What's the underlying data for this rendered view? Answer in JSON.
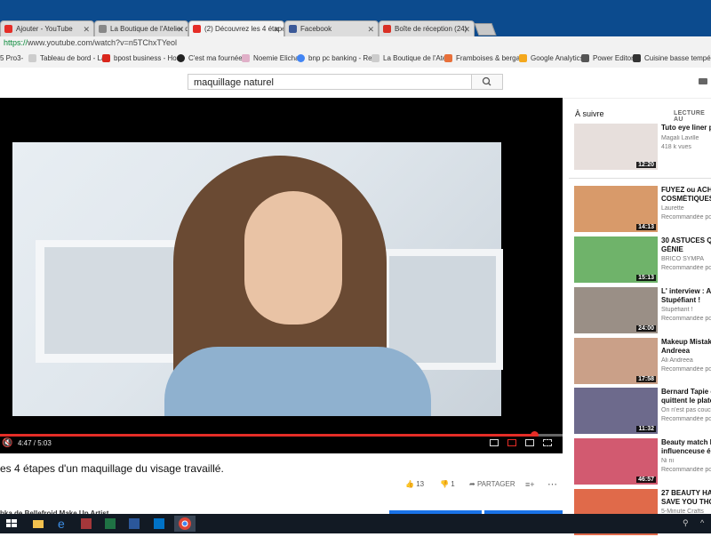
{
  "browser": {
    "tabs": [
      {
        "label": "Ajouter - YouTube",
        "icon": "youtube-icon",
        "color": "#e52d27"
      },
      {
        "label": "La Boutique de l'Atelier d",
        "icon": "page-icon",
        "color": "#888888"
      },
      {
        "label": "(2) Découvrez les 4 étape",
        "icon": "youtube-icon",
        "color": "#e52d27"
      },
      {
        "label": "Facebook",
        "icon": "facebook-icon",
        "color": "#3b5998"
      },
      {
        "label": "Boîte de réception (24)",
        "icon": "gmail-icon",
        "color": "#d93025"
      }
    ],
    "url_scheme": "https://",
    "url_rest": "www.youtube.com/watch?v=n5TChxTYeol",
    "bookmarks": [
      {
        "label": "5 Pro3-",
        "color": "#5a8fd6"
      },
      {
        "label": "Tableau de bord - La",
        "color": "#cccccc"
      },
      {
        "label": "bpost business - Hor",
        "color": "#d9261c"
      },
      {
        "label": "C'est ma fournée |",
        "color": "#222222"
      },
      {
        "label": "Noemie Elicha",
        "color": "#e0b0c8"
      },
      {
        "label": "bnp pc banking - Re",
        "color": "#4285f4"
      },
      {
        "label": "La Boutique de l'Atel",
        "color": "#cccccc"
      },
      {
        "label": "Framboises & berga",
        "color": "#e8703a"
      },
      {
        "label": "Google Analytics",
        "color": "#f4a81d"
      },
      {
        "label": "Power Editor",
        "color": "#555555"
      },
      {
        "label": "Cuisine basse tempé",
        "color": "#333333"
      }
    ]
  },
  "youtube": {
    "search_value": "maquillage naturel",
    "video": {
      "time": "4:47 / 5:03",
      "progress": 0.95,
      "title": "es 4 étapes d'un maquillage du visage travaillé.",
      "likes": "13",
      "dislikes": "1",
      "share_label": "PARTAGER",
      "channel": "bka de Bellefroid Make Up Artist"
    },
    "sidebar": {
      "up_next": "À suivre",
      "autoplay": "LECTURE AU",
      "items": [
        {
          "title": "Tuto eye liner po",
          "line2": "",
          "channel": "Magali Laville",
          "meta": "418 k vues",
          "duration": "12:20",
          "thumb_color": "#e7dfdc"
        },
        {
          "title": "FUYEZ ou ACHE",
          "line2": "COSMÉTIQUES",
          "channel": "Laurette",
          "meta": "Recommandée po",
          "duration": "14:13",
          "thumb_color": "#d89a6a"
        },
        {
          "title": "30 ASTUCES QU",
          "line2": "GÉNIE",
          "channel": "BRICO SYMPA",
          "meta": "Recommandée po",
          "duration": "15:13",
          "thumb_color": "#6fb36a"
        },
        {
          "title": "L' interview : Ala",
          "line2": "Stupéfiant !",
          "channel": "Stupéfiant !",
          "meta": "Recommandée po",
          "duration": "24:00",
          "thumb_color": "#9a8f86"
        },
        {
          "title": "Makeup Mistake",
          "line2": "Andreea",
          "channel": "Ali Andreea",
          "meta": "Recommandée po",
          "duration": "17:58",
          "thumb_color": "#caa088"
        },
        {
          "title": "Bernard Tapie et",
          "line2": "quittent le platea",
          "channel": "On n'est pas couc",
          "meta": "Recommandée po",
          "duration": "11:32",
          "thumb_color": "#6d6a8c"
        },
        {
          "title": "Beauty match le",
          "line2": "influenceuse ép",
          "channel": "Ni ni",
          "meta": "Recommandée po",
          "duration": "46:57",
          "thumb_color": "#d25a70"
        },
        {
          "title": "27 BEAUTY HAC",
          "line2": "SAVE YOU THOU",
          "channel": "5-Minute Crafts",
          "meta": "",
          "duration": "",
          "thumb_color": "#e06a4a"
        }
      ]
    }
  },
  "taskbar": {
    "apps": [
      "windows-start-icon",
      "file-explorer-icon",
      "edge-icon",
      "access-icon",
      "excel-icon",
      "word-icon",
      "outlook-icon",
      "chrome-icon"
    ]
  }
}
